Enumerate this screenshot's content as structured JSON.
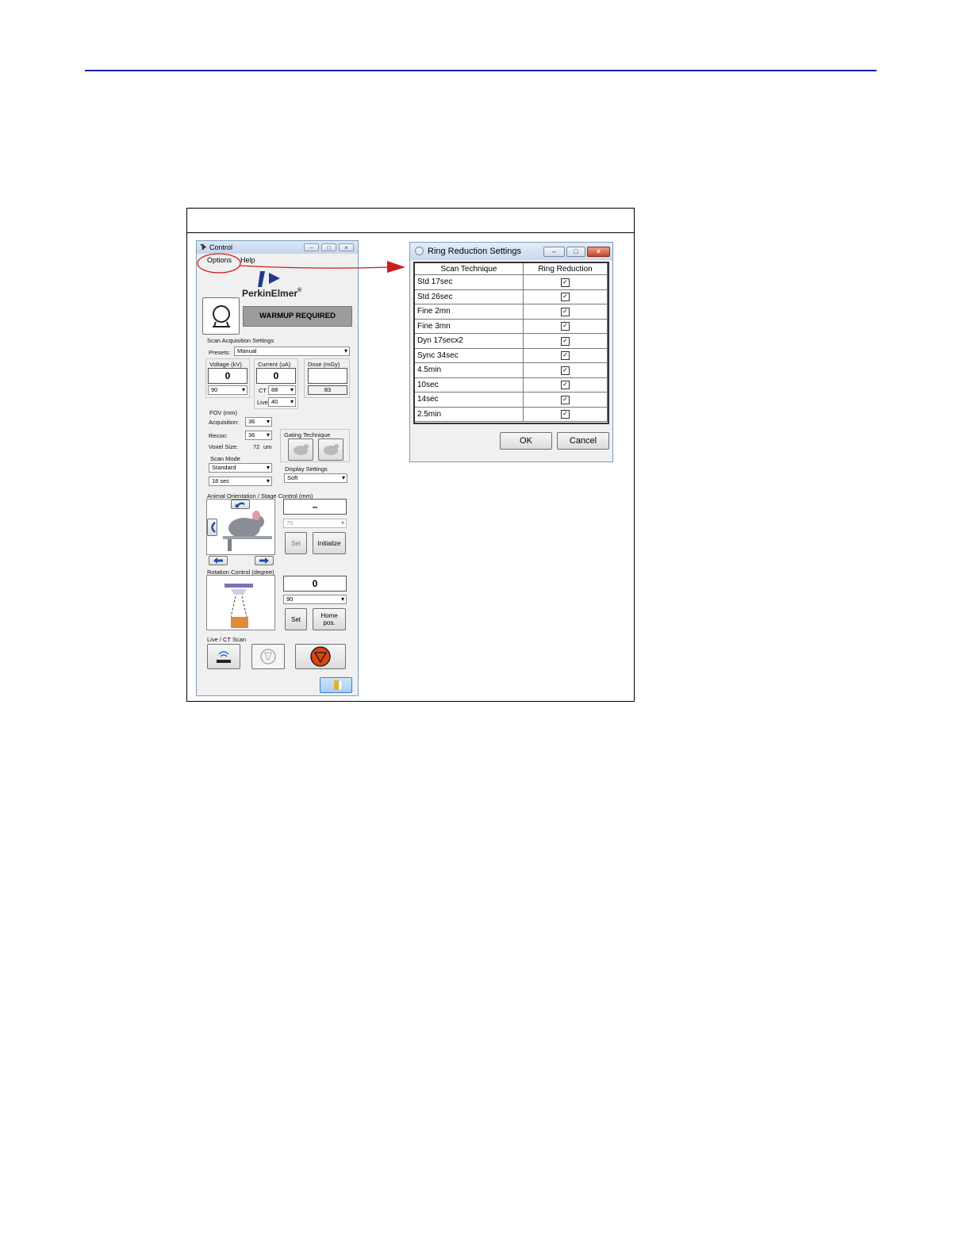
{
  "control": {
    "title": "Control",
    "menu": {
      "options": "Options",
      "help": "Help"
    },
    "brand": {
      "name_bold": "PerkinElmer",
      "trademark": "®"
    },
    "status": "WARMUP REQUIRED",
    "scan_acq": {
      "section_label": "Scan Acquisition Settings",
      "presets_label": "Presets:",
      "presets_value": "Manual",
      "voltage_label": "Voltage (kV)",
      "voltage_value": "0",
      "voltage_select": "90",
      "current_label": "Current (uA)",
      "current_value": "0",
      "ct_label": "CT",
      "ct_select": "88",
      "live_label": "Live",
      "live_select": "40",
      "dose_label": "Dose (mGy)",
      "dose_value": "",
      "dose_readout": "83"
    },
    "fov": {
      "label": "FOV (mm)",
      "acquisition_label": "Acquisition:",
      "acquisition_value": "36",
      "recon_label": "Recon:",
      "recon_value": "36",
      "voxel_label": "Voxel Size:",
      "voxel_value": "72",
      "voxel_unit": "um"
    },
    "gating_label": "Gating Technique",
    "scan_mode": {
      "label": "Scan Mode",
      "mode": "Standard",
      "time": "18 sec"
    },
    "display": {
      "label": "Display Settings",
      "value": "Soft"
    },
    "stage": {
      "label": "Animal Orientation / Stage Control (mm)",
      "value": "–",
      "select": "70",
      "set_label": "Set",
      "init_label": "Initialize"
    },
    "rotation": {
      "label": "Rotation Control (degree)",
      "value": "0",
      "select": "90",
      "set_label": "Set",
      "home_label": "Home pos."
    },
    "live_ct_label": "Live / CT Scan"
  },
  "dialog": {
    "title": "Ring Reduction Settings",
    "columns": [
      "Scan Technique",
      "Ring Reduction"
    ],
    "rows": [
      {
        "technique": "Std 17sec",
        "checked": true
      },
      {
        "technique": "Std 26sec",
        "checked": true
      },
      {
        "technique": "Fine 2mn",
        "checked": true
      },
      {
        "technique": "Fine 3mn",
        "checked": true
      },
      {
        "technique": "Dyn 17secx2",
        "checked": true
      },
      {
        "technique": "Sync 34sec",
        "checked": true
      },
      {
        "technique": "4.5min",
        "checked": true
      },
      {
        "technique": "10sec",
        "checked": true
      },
      {
        "technique": "14sec",
        "checked": true
      },
      {
        "technique": "2.5min",
        "checked": true
      }
    ],
    "ok_label": "OK",
    "cancel_label": "Cancel"
  },
  "colors": {
    "rule": "#1a1f9c",
    "annotation": "#cc1f1f",
    "brand": "#1e3a8a",
    "stop_button": "#e0440e"
  }
}
